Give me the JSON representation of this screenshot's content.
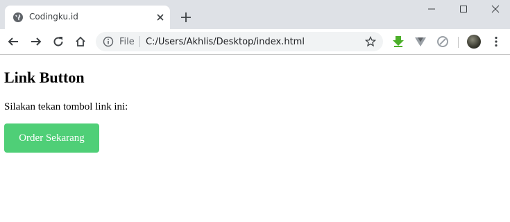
{
  "browser": {
    "tab": {
      "title": "Codingku.id",
      "favicon": "globe-icon"
    },
    "omnibox": {
      "scheme_label": "File",
      "url": "C:/Users/Akhlis/Desktop/index.html"
    },
    "extensions": [
      "download-arrow-icon",
      "vue-icon",
      "blocked-circle-icon"
    ],
    "window_controls": [
      "minimize-icon",
      "maximize-icon",
      "close-icon"
    ]
  },
  "page": {
    "heading": "Link Button",
    "paragraph": "Silakan tekan tombol link ini:",
    "button_label": "Order Sekarang",
    "button_color": "#4fcf77"
  }
}
